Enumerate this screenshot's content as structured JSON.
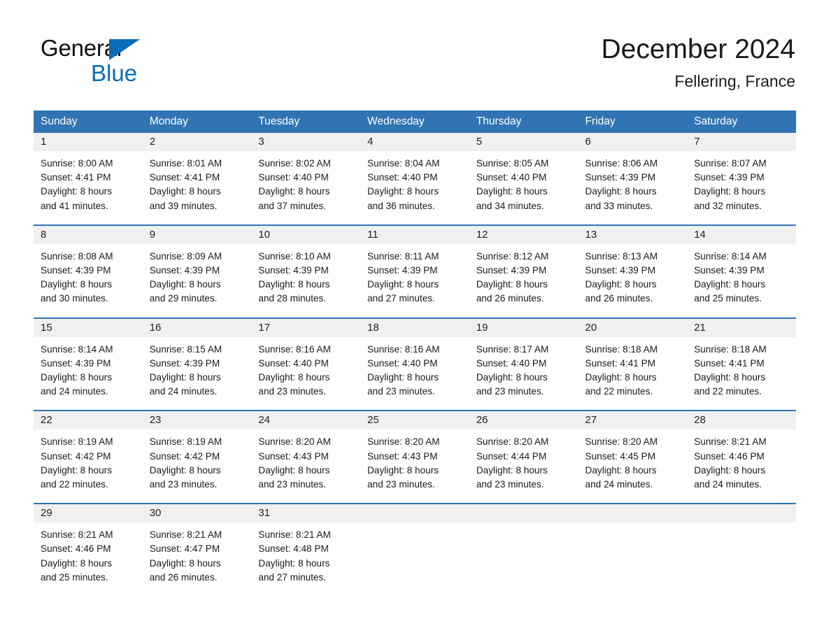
{
  "brand": {
    "word1": "General",
    "word2": "Blue",
    "triangle_icon": "triangle-right-icon",
    "colors": {
      "word1": "#111111",
      "word2": "#0b6cb7",
      "triangle": "#0b6cb7"
    }
  },
  "header": {
    "title": "December 2024",
    "subtitle": "Fellering, France"
  },
  "colors": {
    "header_blue": "#3174b4",
    "row_divider_blue": "#3174b4",
    "daynum_band": "#f0f0f0",
    "text": "#1a1a1a",
    "page_background": "#ffffff"
  },
  "calendar": {
    "weekday_headers": [
      "Sunday",
      "Monday",
      "Tuesday",
      "Wednesday",
      "Thursday",
      "Friday",
      "Saturday"
    ],
    "weeks": [
      [
        {
          "day": "1",
          "lines": [
            "Sunrise: 8:00 AM",
            "Sunset: 4:41 PM",
            "Daylight: 8 hours",
            "and 41 minutes."
          ]
        },
        {
          "day": "2",
          "lines": [
            "Sunrise: 8:01 AM",
            "Sunset: 4:41 PM",
            "Daylight: 8 hours",
            "and 39 minutes."
          ]
        },
        {
          "day": "3",
          "lines": [
            "Sunrise: 8:02 AM",
            "Sunset: 4:40 PM",
            "Daylight: 8 hours",
            "and 37 minutes."
          ]
        },
        {
          "day": "4",
          "lines": [
            "Sunrise: 8:04 AM",
            "Sunset: 4:40 PM",
            "Daylight: 8 hours",
            "and 36 minutes."
          ]
        },
        {
          "day": "5",
          "lines": [
            "Sunrise: 8:05 AM",
            "Sunset: 4:40 PM",
            "Daylight: 8 hours",
            "and 34 minutes."
          ]
        },
        {
          "day": "6",
          "lines": [
            "Sunrise: 8:06 AM",
            "Sunset: 4:39 PM",
            "Daylight: 8 hours",
            "and 33 minutes."
          ]
        },
        {
          "day": "7",
          "lines": [
            "Sunrise: 8:07 AM",
            "Sunset: 4:39 PM",
            "Daylight: 8 hours",
            "and 32 minutes."
          ]
        }
      ],
      [
        {
          "day": "8",
          "lines": [
            "Sunrise: 8:08 AM",
            "Sunset: 4:39 PM",
            "Daylight: 8 hours",
            "and 30 minutes."
          ]
        },
        {
          "day": "9",
          "lines": [
            "Sunrise: 8:09 AM",
            "Sunset: 4:39 PM",
            "Daylight: 8 hours",
            "and 29 minutes."
          ]
        },
        {
          "day": "10",
          "lines": [
            "Sunrise: 8:10 AM",
            "Sunset: 4:39 PM",
            "Daylight: 8 hours",
            "and 28 minutes."
          ]
        },
        {
          "day": "11",
          "lines": [
            "Sunrise: 8:11 AM",
            "Sunset: 4:39 PM",
            "Daylight: 8 hours",
            "and 27 minutes."
          ]
        },
        {
          "day": "12",
          "lines": [
            "Sunrise: 8:12 AM",
            "Sunset: 4:39 PM",
            "Daylight: 8 hours",
            "and 26 minutes."
          ]
        },
        {
          "day": "13",
          "lines": [
            "Sunrise: 8:13 AM",
            "Sunset: 4:39 PM",
            "Daylight: 8 hours",
            "and 26 minutes."
          ]
        },
        {
          "day": "14",
          "lines": [
            "Sunrise: 8:14 AM",
            "Sunset: 4:39 PM",
            "Daylight: 8 hours",
            "and 25 minutes."
          ]
        }
      ],
      [
        {
          "day": "15",
          "lines": [
            "Sunrise: 8:14 AM",
            "Sunset: 4:39 PM",
            "Daylight: 8 hours",
            "and 24 minutes."
          ]
        },
        {
          "day": "16",
          "lines": [
            "Sunrise: 8:15 AM",
            "Sunset: 4:39 PM",
            "Daylight: 8 hours",
            "and 24 minutes."
          ]
        },
        {
          "day": "17",
          "lines": [
            "Sunrise: 8:16 AM",
            "Sunset: 4:40 PM",
            "Daylight: 8 hours",
            "and 23 minutes."
          ]
        },
        {
          "day": "18",
          "lines": [
            "Sunrise: 8:16 AM",
            "Sunset: 4:40 PM",
            "Daylight: 8 hours",
            "and 23 minutes."
          ]
        },
        {
          "day": "19",
          "lines": [
            "Sunrise: 8:17 AM",
            "Sunset: 4:40 PM",
            "Daylight: 8 hours",
            "and 23 minutes."
          ]
        },
        {
          "day": "20",
          "lines": [
            "Sunrise: 8:18 AM",
            "Sunset: 4:41 PM",
            "Daylight: 8 hours",
            "and 22 minutes."
          ]
        },
        {
          "day": "21",
          "lines": [
            "Sunrise: 8:18 AM",
            "Sunset: 4:41 PM",
            "Daylight: 8 hours",
            "and 22 minutes."
          ]
        }
      ],
      [
        {
          "day": "22",
          "lines": [
            "Sunrise: 8:19 AM",
            "Sunset: 4:42 PM",
            "Daylight: 8 hours",
            "and 22 minutes."
          ]
        },
        {
          "day": "23",
          "lines": [
            "Sunrise: 8:19 AM",
            "Sunset: 4:42 PM",
            "Daylight: 8 hours",
            "and 23 minutes."
          ]
        },
        {
          "day": "24",
          "lines": [
            "Sunrise: 8:20 AM",
            "Sunset: 4:43 PM",
            "Daylight: 8 hours",
            "and 23 minutes."
          ]
        },
        {
          "day": "25",
          "lines": [
            "Sunrise: 8:20 AM",
            "Sunset: 4:43 PM",
            "Daylight: 8 hours",
            "and 23 minutes."
          ]
        },
        {
          "day": "26",
          "lines": [
            "Sunrise: 8:20 AM",
            "Sunset: 4:44 PM",
            "Daylight: 8 hours",
            "and 23 minutes."
          ]
        },
        {
          "day": "27",
          "lines": [
            "Sunrise: 8:20 AM",
            "Sunset: 4:45 PM",
            "Daylight: 8 hours",
            "and 24 minutes."
          ]
        },
        {
          "day": "28",
          "lines": [
            "Sunrise: 8:21 AM",
            "Sunset: 4:46 PM",
            "Daylight: 8 hours",
            "and 24 minutes."
          ]
        }
      ],
      [
        {
          "day": "29",
          "lines": [
            "Sunrise: 8:21 AM",
            "Sunset: 4:46 PM",
            "Daylight: 8 hours",
            "and 25 minutes."
          ]
        },
        {
          "day": "30",
          "lines": [
            "Sunrise: 8:21 AM",
            "Sunset: 4:47 PM",
            "Daylight: 8 hours",
            "and 26 minutes."
          ]
        },
        {
          "day": "31",
          "lines": [
            "Sunrise: 8:21 AM",
            "Sunset: 4:48 PM",
            "Daylight: 8 hours",
            "and 27 minutes."
          ]
        },
        {
          "day": "",
          "lines": []
        },
        {
          "day": "",
          "lines": []
        },
        {
          "day": "",
          "lines": []
        },
        {
          "day": "",
          "lines": []
        }
      ]
    ]
  }
}
